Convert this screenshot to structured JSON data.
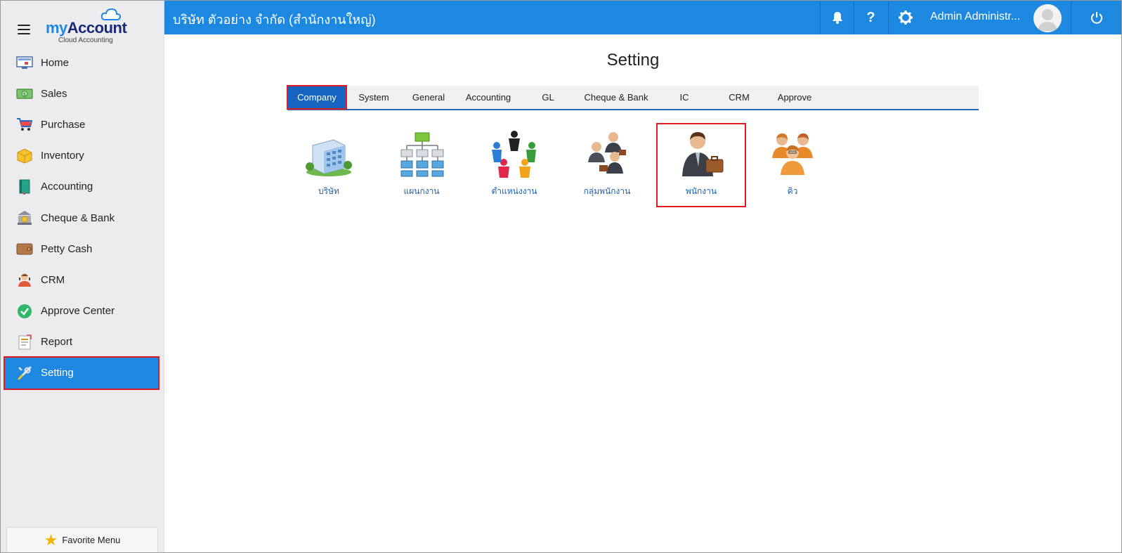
{
  "brand": {
    "name_prefix": "my",
    "name_suffix": "Account",
    "subtitle": "Cloud Accounting"
  },
  "topbar": {
    "company": "บริษัท ตัวอย่าง จำกัด (สำนักงานใหญ่)",
    "user": "Admin Administr...",
    "icons": [
      "bell-icon",
      "help-icon",
      "gear-icon",
      "power-icon"
    ]
  },
  "sidebar": {
    "items": [
      {
        "label": "Home",
        "icon": "home-icon"
      },
      {
        "label": "Sales",
        "icon": "money-icon"
      },
      {
        "label": "Purchase",
        "icon": "cart-icon"
      },
      {
        "label": "Inventory",
        "icon": "box-icon"
      },
      {
        "label": "Accounting",
        "icon": "book-icon"
      },
      {
        "label": "Cheque & Bank",
        "icon": "bank-icon"
      },
      {
        "label": "Petty Cash",
        "icon": "wallet-icon"
      },
      {
        "label": "CRM",
        "icon": "person-icon"
      },
      {
        "label": "Approve Center",
        "icon": "check-icon"
      },
      {
        "label": "Report",
        "icon": "report-icon"
      },
      {
        "label": "Setting",
        "icon": "tools-icon",
        "active": true
      }
    ],
    "favorite": "Favorite Menu"
  },
  "main": {
    "title": "Setting",
    "tabs": [
      "Company",
      "System",
      "General",
      "Accounting",
      "GL",
      "Cheque & Bank",
      "IC",
      "CRM",
      "Approve"
    ],
    "active_tab": "Company",
    "icons": [
      {
        "label": "บริษัท",
        "icon": "building-icon"
      },
      {
        "label": "แผนกงาน",
        "icon": "org-chart-icon"
      },
      {
        "label": "ตำแหน่งงาน",
        "icon": "people-circle-icon"
      },
      {
        "label": "กลุ่มพนักงาน",
        "icon": "group-icon"
      },
      {
        "label": "พนักงาน",
        "icon": "employee-icon",
        "selected": true
      },
      {
        "label": "คิว",
        "icon": "team-icon"
      }
    ]
  },
  "colors": {
    "primary": "#1c88e0",
    "active_tab": "#1565c0",
    "highlight": "#e11b24",
    "sidebar_bg": "#ececee"
  }
}
